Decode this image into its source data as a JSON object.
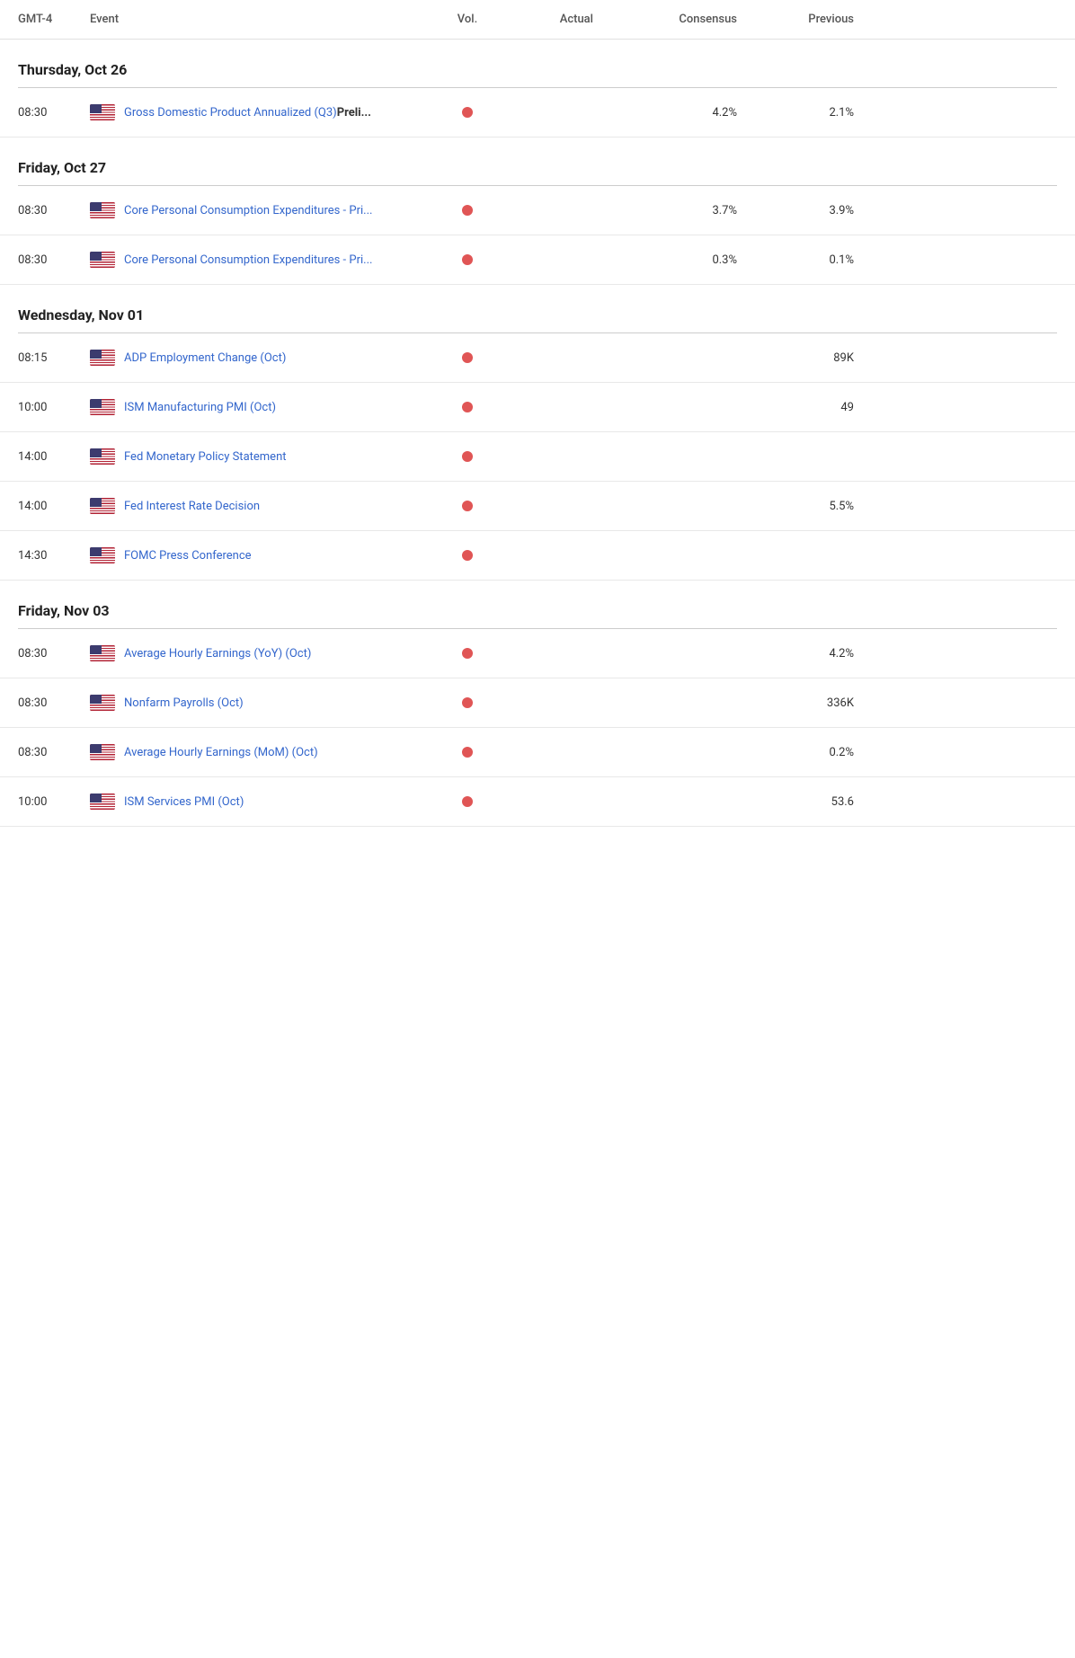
{
  "header": {
    "timezone": "GMT-4",
    "event_label": "Event",
    "vol_label": "Vol.",
    "actual_label": "Actual",
    "consensus_label": "Consensus",
    "previous_label": "Previous"
  },
  "sections": [
    {
      "date": "Thursday, Oct 26",
      "events": [
        {
          "time": "08:30",
          "flag": "us",
          "name": "Gross Domestic Product Annualized (Q3)",
          "name_bold": "Preli...",
          "has_dot": true,
          "actual": "",
          "consensus": "4.2%",
          "previous": "2.1%"
        }
      ]
    },
    {
      "date": "Friday, Oct 27",
      "events": [
        {
          "time": "08:30",
          "flag": "us",
          "name": "Core Personal Consumption Expenditures - Pri...",
          "name_bold": "",
          "has_dot": true,
          "actual": "",
          "consensus": "3.7%",
          "previous": "3.9%"
        },
        {
          "time": "08:30",
          "flag": "us",
          "name": "Core Personal Consumption Expenditures - Pri...",
          "name_bold": "",
          "has_dot": true,
          "actual": "",
          "consensus": "0.3%",
          "previous": "0.1%"
        }
      ]
    },
    {
      "date": "Wednesday, Nov 01",
      "events": [
        {
          "time": "08:15",
          "flag": "us",
          "name": "ADP Employment Change (Oct)",
          "name_bold": "",
          "has_dot": true,
          "actual": "",
          "consensus": "",
          "previous": "89K"
        },
        {
          "time": "10:00",
          "flag": "us",
          "name": "ISM Manufacturing PMI (Oct)",
          "name_bold": "",
          "has_dot": true,
          "actual": "",
          "consensus": "",
          "previous": "49"
        },
        {
          "time": "14:00",
          "flag": "us",
          "name": "Fed Monetary Policy Statement",
          "name_bold": "",
          "has_dot": true,
          "actual": "",
          "consensus": "",
          "previous": ""
        },
        {
          "time": "14:00",
          "flag": "us",
          "name": "Fed Interest Rate Decision",
          "name_bold": "",
          "has_dot": true,
          "actual": "",
          "consensus": "",
          "previous": "5.5%"
        },
        {
          "time": "14:30",
          "flag": "us",
          "name": "FOMC Press Conference",
          "name_bold": "",
          "has_dot": true,
          "actual": "",
          "consensus": "",
          "previous": ""
        }
      ]
    },
    {
      "date": "Friday, Nov 03",
      "events": [
        {
          "time": "08:30",
          "flag": "us",
          "name": "Average Hourly Earnings (YoY) (Oct)",
          "name_bold": "",
          "has_dot": true,
          "actual": "",
          "consensus": "",
          "previous": "4.2%"
        },
        {
          "time": "08:30",
          "flag": "us",
          "name": "Nonfarm Payrolls (Oct)",
          "name_bold": "",
          "has_dot": true,
          "actual": "",
          "consensus": "",
          "previous": "336K"
        },
        {
          "time": "08:30",
          "flag": "us",
          "name": "Average Hourly Earnings (MoM) (Oct)",
          "name_bold": "",
          "has_dot": true,
          "actual": "",
          "consensus": "",
          "previous": "0.2%"
        },
        {
          "time": "10:00",
          "flag": "us",
          "name": "ISM Services PMI (Oct)",
          "name_bold": "",
          "has_dot": true,
          "actual": "",
          "consensus": "",
          "previous": "53.6"
        }
      ]
    }
  ]
}
